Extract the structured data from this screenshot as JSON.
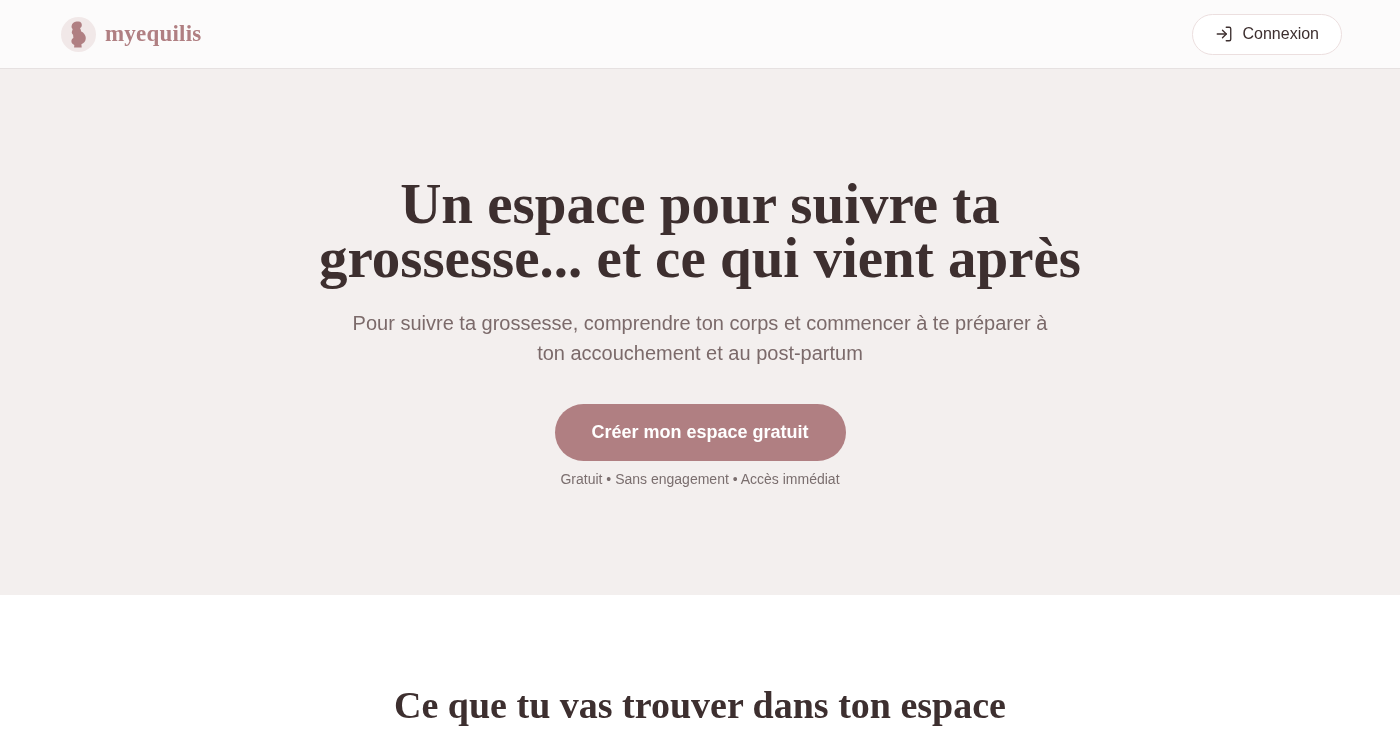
{
  "header": {
    "logo": {
      "text": "myequilis"
    },
    "login_button": {
      "label": "Connexion"
    }
  },
  "hero": {
    "title": "Un espace pour suivre ta grossesse... et ce qui vient après",
    "subtitle": "Pour suivre ta grossesse, comprendre ton corps et commencer à te préparer à ton accouchement et au post-partum",
    "cta_button": {
      "label": "Créer mon espace gratuit"
    },
    "note": "Gratuit • Sans engagement • Accès immédiat"
  },
  "features": {
    "title": "Ce que tu vas trouver dans ton espace"
  }
}
